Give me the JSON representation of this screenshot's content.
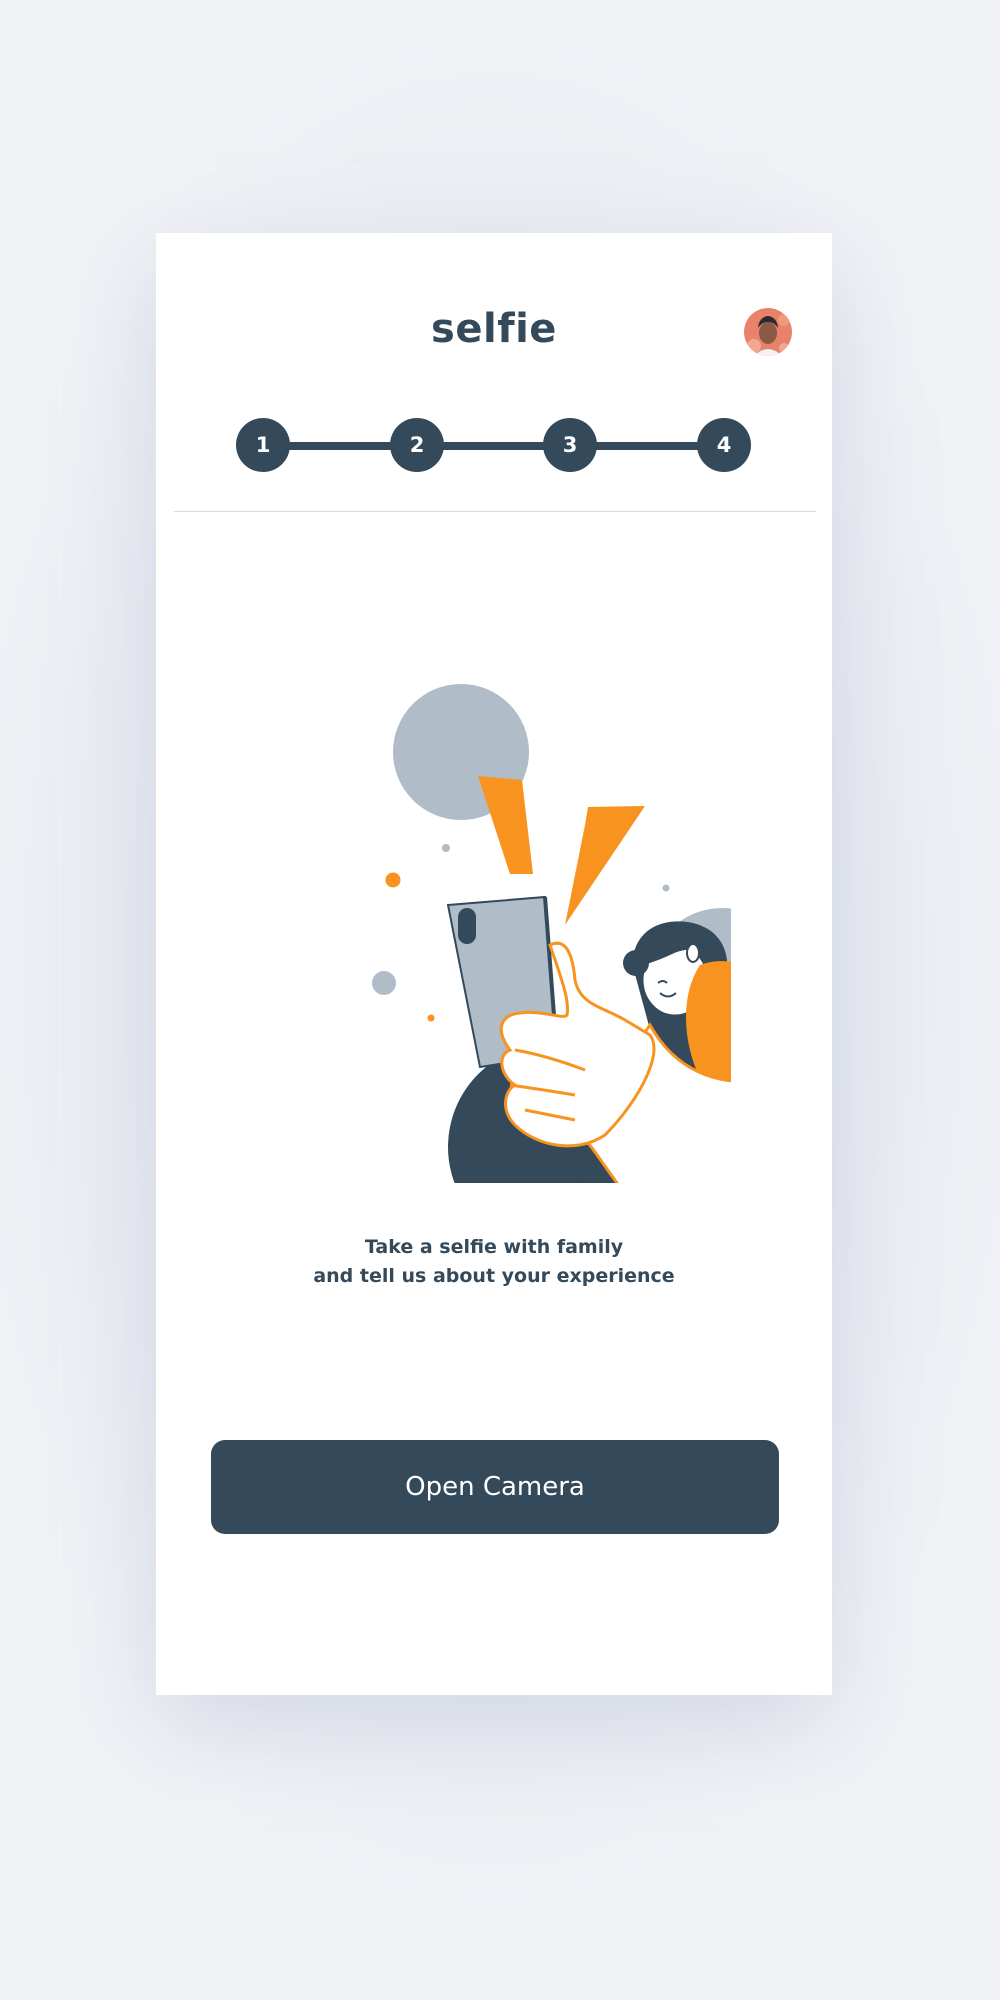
{
  "header": {
    "title": "selfie"
  },
  "stepper": {
    "steps": [
      "1",
      "2",
      "3",
      "4"
    ]
  },
  "illustration": {
    "icon": "selfie-illustration"
  },
  "description": {
    "line1": "Take a selfie with family",
    "line2": "and tell us about your experience"
  },
  "actions": {
    "open_camera_label": "Open Camera"
  },
  "colors": {
    "primary": "#34495a",
    "accent": "#f7931e",
    "muted": "#b0bcc8",
    "background": "#f0f2f6",
    "card": "#ffffff"
  }
}
